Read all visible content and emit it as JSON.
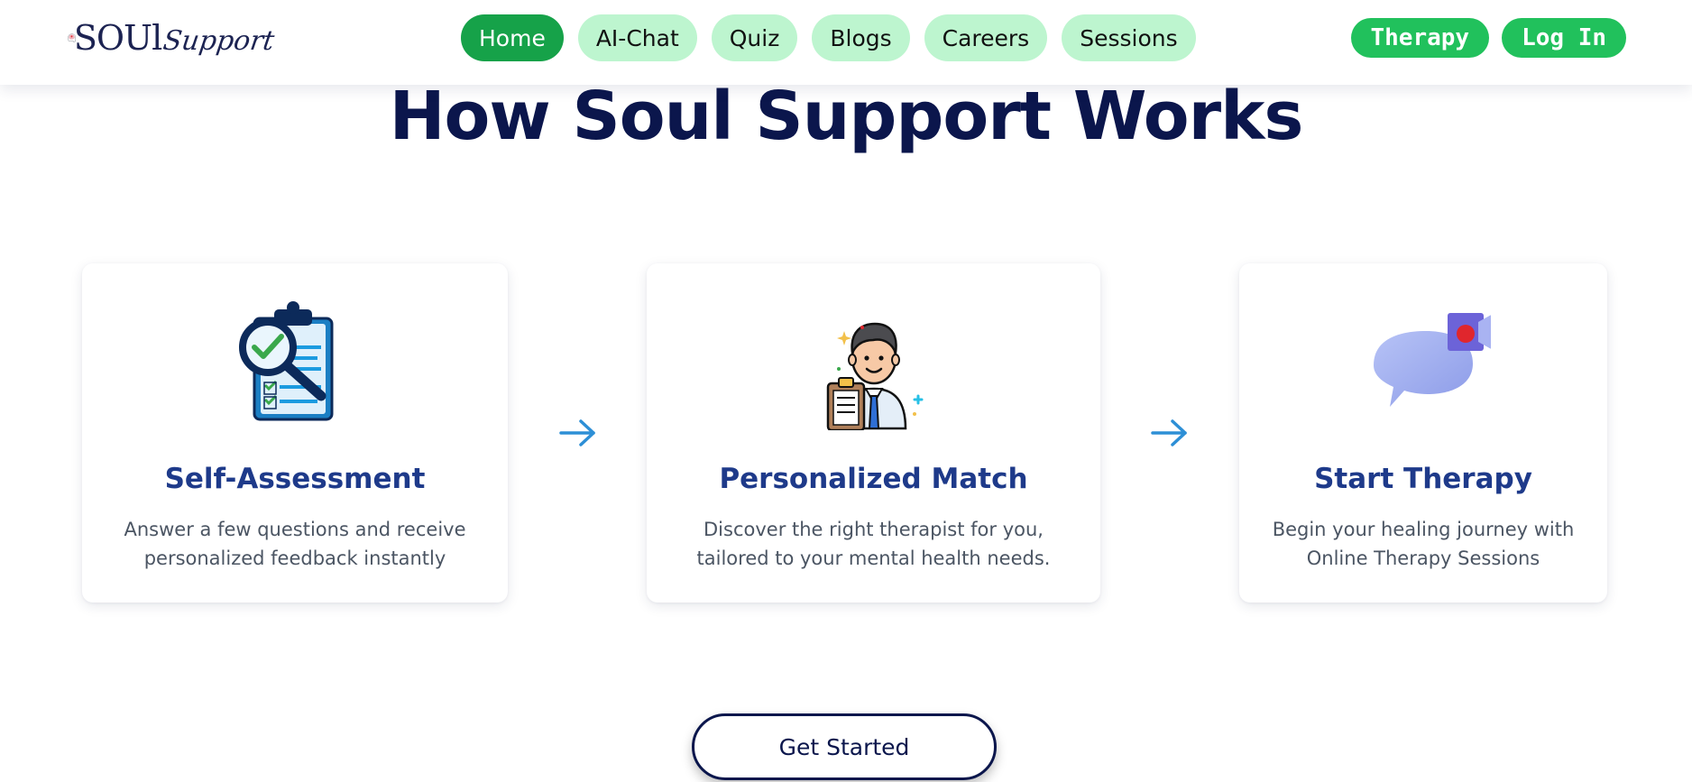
{
  "header": {
    "logo": {
      "text_primary": "SOUl",
      "text_secondary": "Support"
    },
    "nav": [
      {
        "label": "Home",
        "active": true
      },
      {
        "label": "AI-Chat",
        "active": false
      },
      {
        "label": "Quiz",
        "active": false
      },
      {
        "label": "Blogs",
        "active": false
      },
      {
        "label": "Careers",
        "active": false
      },
      {
        "label": "Sessions",
        "active": false
      }
    ],
    "auth": {
      "therapy_label": "Therapy",
      "login_label": "Log In"
    }
  },
  "main": {
    "title": "How Soul Support Works",
    "steps": [
      {
        "icon": "clipboard-magnifier-icon",
        "title": "Self-Assessment",
        "description": "Answer a few questions and receive personalized feedback instantly"
      },
      {
        "icon": "doctor-icon",
        "title": "Personalized Match",
        "description": "Discover the right therapist for you, tailored to your mental health needs."
      },
      {
        "icon": "video-chat-icon",
        "title": "Start Therapy",
        "description": "Begin your healing journey with Online Therapy Sessions"
      }
    ],
    "cta_label": "Get Started"
  },
  "colors": {
    "nav_active": "#16a249",
    "nav_inactive": "#bdf5cf",
    "auth_button": "#21c15c",
    "title": "#0b164c",
    "card_title": "#1e3a8a",
    "arrow": "#2d8fd6"
  }
}
